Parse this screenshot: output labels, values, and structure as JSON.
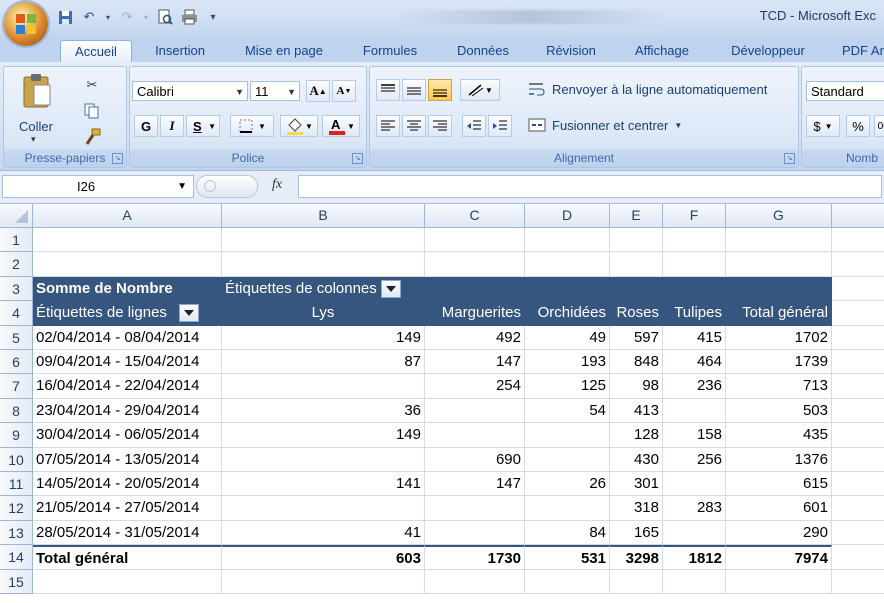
{
  "window": {
    "title": "TCD - Microsoft Exc"
  },
  "ribbon": {
    "tabs": [
      "Accueil",
      "Insertion",
      "Mise en page",
      "Formules",
      "Données",
      "Révision",
      "Affichage",
      "Développeur",
      "PDF Ar"
    ],
    "clipboard": {
      "paste_label": "Coller",
      "group_label": "Presse-papiers"
    },
    "font": {
      "name": "Calibri",
      "size": "11",
      "group_label": "Police",
      "bold": "G",
      "italic": "I",
      "underline": "S"
    },
    "alignment": {
      "wrap_label": "Renvoyer à la ligne automatiquement",
      "merge_label": "Fusionner et centrer",
      "group_label": "Alignement"
    },
    "number": {
      "format": "Standard",
      "currency": "$",
      "percent": "%",
      "group_label": "Nomb"
    }
  },
  "formula_bar": {
    "name_box": "I26",
    "fx": "fx",
    "formula": ""
  },
  "sheet": {
    "columns": [
      "A",
      "B",
      "C",
      "D",
      "E",
      "F",
      "G"
    ],
    "rows": [
      "1",
      "2",
      "3",
      "4",
      "5",
      "6",
      "7",
      "8",
      "9",
      "10",
      "11",
      "12",
      "13",
      "14",
      "15"
    ],
    "pivot": {
      "value_label": "Somme de Nombre",
      "col_field_label": "Étiquettes de colonnes",
      "row_field_label": "Étiquettes de lignes",
      "col_headers": [
        "Lys",
        "Marguerites",
        "Orchidées",
        "Roses",
        "Tulipes",
        "Total général"
      ],
      "data_rows": [
        {
          "label": "02/04/2014 - 08/04/2014",
          "values": [
            "149",
            "492",
            "49",
            "597",
            "415",
            "1702"
          ]
        },
        {
          "label": "09/04/2014 - 15/04/2014",
          "values": [
            "87",
            "147",
            "193",
            "848",
            "464",
            "1739"
          ]
        },
        {
          "label": "16/04/2014 - 22/04/2014",
          "values": [
            "",
            "254",
            "125",
            "98",
            "236",
            "713"
          ]
        },
        {
          "label": "23/04/2014 - 29/04/2014",
          "values": [
            "36",
            "",
            "54",
            "413",
            "",
            "503"
          ]
        },
        {
          "label": "30/04/2014 - 06/05/2014",
          "values": [
            "149",
            "",
            "",
            "128",
            "158",
            "435"
          ]
        },
        {
          "label": "07/05/2014 - 13/05/2014",
          "values": [
            "",
            "690",
            "",
            "430",
            "256",
            "1376"
          ]
        },
        {
          "label": "14/05/2014 - 20/05/2014",
          "values": [
            "141",
            "147",
            "26",
            "301",
            "",
            "615"
          ]
        },
        {
          "label": "21/05/2014 - 27/05/2014",
          "values": [
            "",
            "",
            "",
            "318",
            "283",
            "601"
          ]
        },
        {
          "label": "28/05/2014 - 31/05/2014",
          "values": [
            "41",
            "",
            "84",
            "165",
            "",
            "290"
          ]
        }
      ],
      "total_row": {
        "label": "Total général",
        "values": [
          "603",
          "1730",
          "531",
          "3298",
          "1812",
          "7974"
        ]
      }
    }
  }
}
